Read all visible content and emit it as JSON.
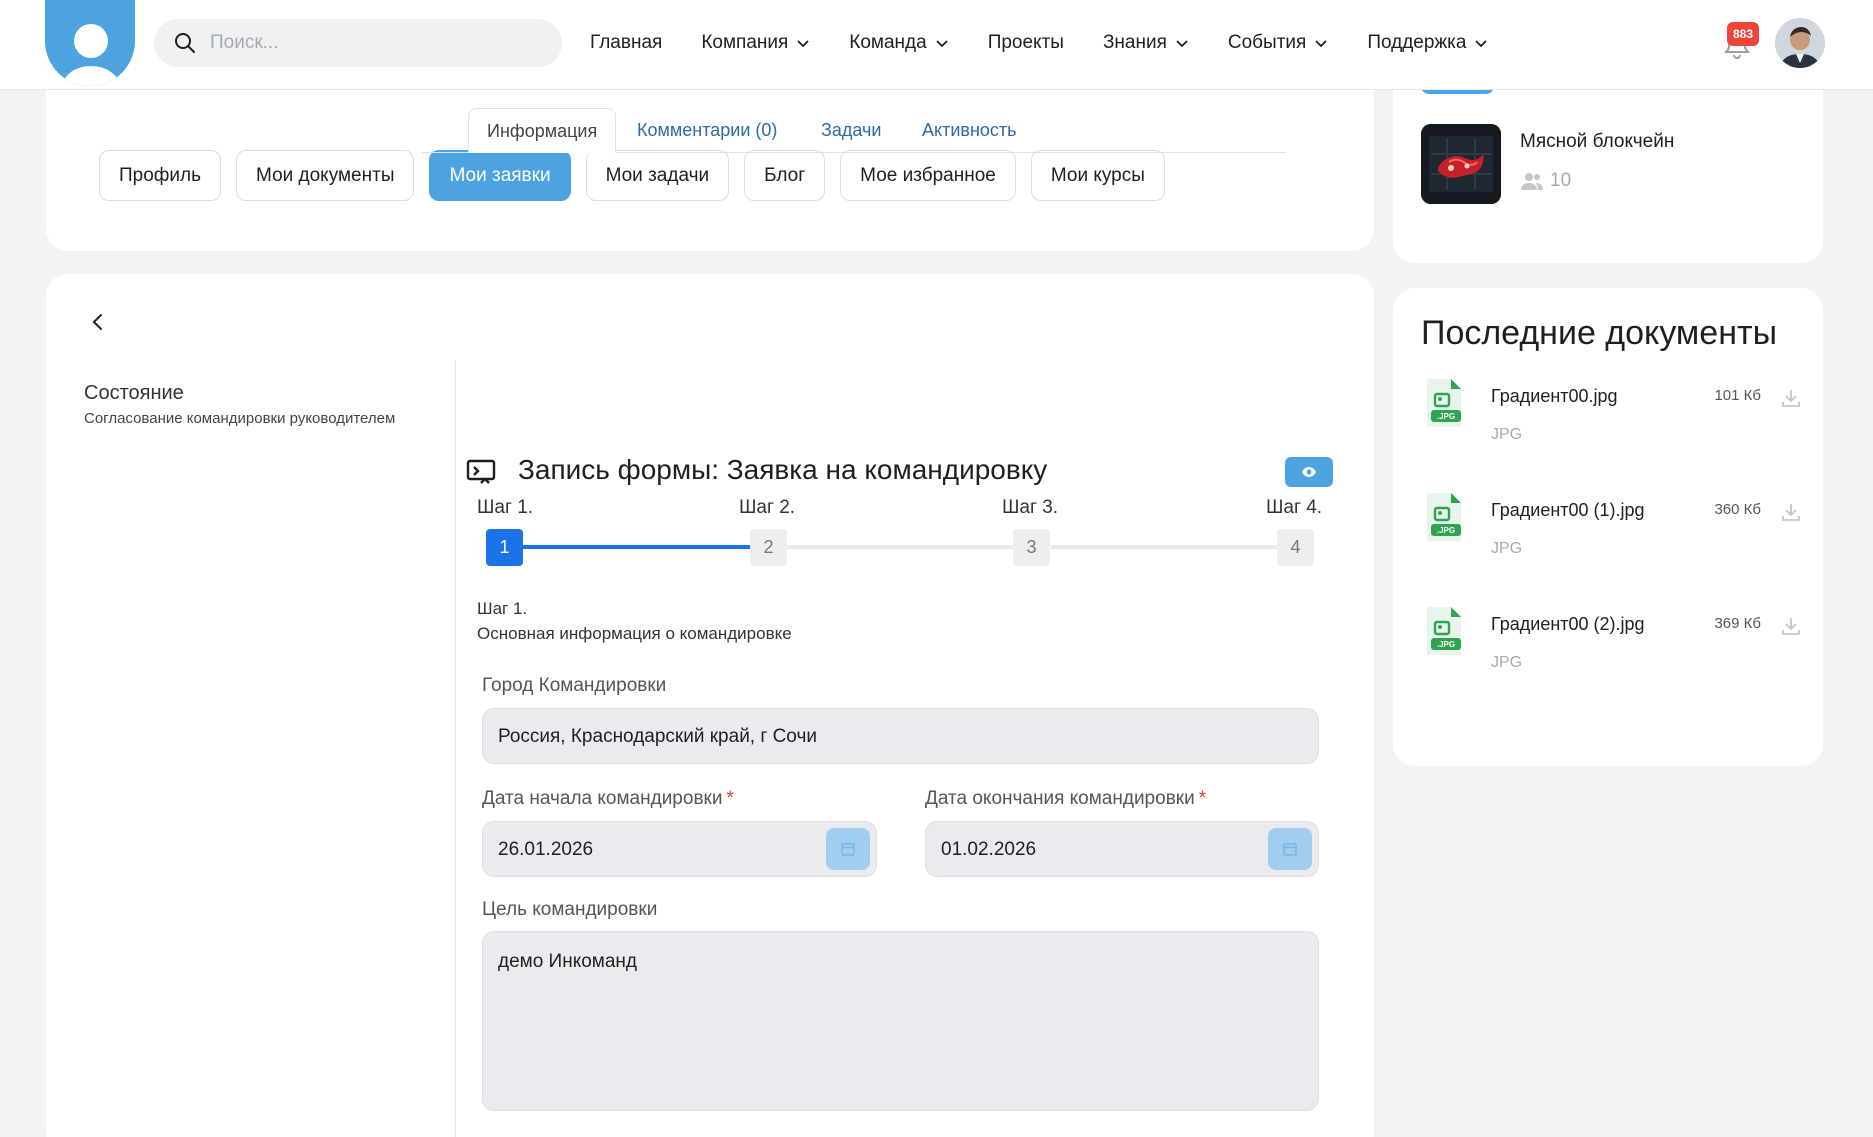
{
  "header": {
    "search_placeholder": "Поиск...",
    "nav": [
      {
        "label": "Главная",
        "dropdown": false
      },
      {
        "label": "Компания",
        "dropdown": true
      },
      {
        "label": "Команда",
        "dropdown": true
      },
      {
        "label": "Проекты",
        "dropdown": false
      },
      {
        "label": "Знания",
        "dropdown": true
      },
      {
        "label": "События",
        "dropdown": true
      },
      {
        "label": "Поддержка",
        "dropdown": true
      }
    ],
    "notifications_count": "883",
    "accent_color": "#4da3e0"
  },
  "profile_tabs": [
    {
      "label": "Профиль",
      "active": false
    },
    {
      "label": "Мои документы",
      "active": false
    },
    {
      "label": "Мои заявки",
      "active": true
    },
    {
      "label": "Мои задачи",
      "active": false
    },
    {
      "label": "Блог",
      "active": false
    },
    {
      "label": "Мое избранное",
      "active": false
    },
    {
      "label": "Мои курсы",
      "active": false
    }
  ],
  "request": {
    "state_title": "Состояние",
    "state_value": "Согласование командировки руководителем",
    "tabs": [
      {
        "label": "Информация",
        "active": true
      },
      {
        "label": "Комментарии (0)",
        "active": false
      },
      {
        "label": "Задачи",
        "active": false
      },
      {
        "label": "Активность",
        "active": false
      }
    ],
    "form_title": "Запись формы: Заявка на командировку",
    "steps": [
      {
        "label": "Шаг 1.",
        "number": "1",
        "active": true
      },
      {
        "label": "Шаг 2.",
        "number": "2",
        "active": false
      },
      {
        "label": "Шаг 3.",
        "number": "3",
        "active": false
      },
      {
        "label": "Шаг 4.",
        "number": "4",
        "active": false
      }
    ],
    "current_step_name": "Шаг 1.",
    "current_step_desc": "Основная информация о командировке",
    "fields": {
      "city_label": "Город Командировки",
      "city_value": "Россия, Краснодарский край, г Сочи",
      "start_label": "Дата начала командировки",
      "start_value": "26.01.2026",
      "end_label": "Дата окончания командировки",
      "end_value": "01.02.2026",
      "required_mark": "*",
      "purpose_label": "Цель командировки",
      "purpose_value": "демо Инкоманд"
    }
  },
  "sidebar": {
    "group": {
      "name": "Мясной блокчейн",
      "members": "10"
    },
    "docs_title": "Последние документы",
    "documents": [
      {
        "name": "Градиент00.jpg",
        "size": "101 Кб",
        "type": "JPG",
        "ext": ".JPG"
      },
      {
        "name": "Градиент00 (1).jpg",
        "size": "360 Кб",
        "type": "JPG",
        "ext": ".JPG"
      },
      {
        "name": "Градиент00 (2).jpg",
        "size": "369 Кб",
        "type": "JPG",
        "ext": ".JPG"
      }
    ]
  }
}
